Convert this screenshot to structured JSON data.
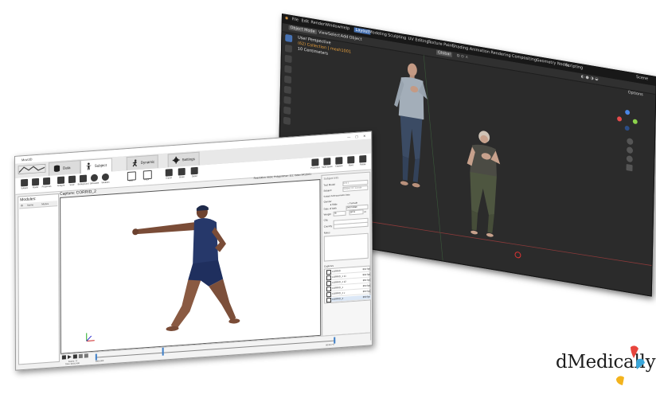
{
  "blender": {
    "menu": [
      "File",
      "Edit",
      "Render",
      "Window",
      "Help"
    ],
    "workspaces": [
      "Layout",
      "Modeling",
      "Sculpting",
      "UV Editing",
      "Texture Paint",
      "Shading",
      "Animation",
      "Rendering",
      "Compositing",
      "Geometry Nodes",
      "Scripting"
    ],
    "active_workspace": "Layout",
    "scene_label": "Scene",
    "header": {
      "mode": "Object Mode",
      "menus": [
        "View",
        "Select",
        "Add",
        "Object"
      ],
      "orientation": "Global",
      "options_label": "Options"
    },
    "overlay": {
      "line1": "User Perspective",
      "line2": "(62) Collection | mesh1001",
      "line3": "10 Centimeters"
    },
    "colors": {
      "active_tab": "#4772b3",
      "axis_x": "#e64a4a",
      "axis_y": "#8bd14b",
      "axis_z": "#4a86e6",
      "overlay_text_orange": "#e8a03c"
    }
  },
  "app": {
    "window_title": "Muvi3D",
    "tabs": [
      {
        "label": "Data",
        "icon": "database-icon"
      },
      {
        "label": "Subject",
        "icon": "person-icon"
      },
      {
        "label": "Dynamic",
        "icon": "running-person-icon"
      },
      {
        "label": "Settings",
        "icon": "gear-icon"
      }
    ],
    "active_tab": "Subject",
    "ribbon_left": [
      "Subject",
      "Model",
      "Properties",
      "Analyze",
      "Save",
      "Background",
      "Silhouette",
      "Skeleton"
    ],
    "ribbon_mid": [
      "Grid",
      "Floor"
    ],
    "ribbon_right": [
      "Export",
      "Share",
      "Detail"
    ],
    "action_buttons": [
      "Properties",
      "Save scene",
      "Capture",
      "Store",
      "Rotate"
    ],
    "modules_label": "Modules:",
    "modules_columns": [
      "Name",
      "Modes"
    ],
    "capture_title": "Capture: CORRID_2",
    "capture_stats": "Resolution: 960x; Polygonmax: 111; Index 8412021",
    "right_panel": {
      "title": "Subject Info",
      "fields": [
        {
          "label": "Test Model",
          "value": "Unit 1"
        },
        {
          "label": "Subject",
          "value": "Subject_02_Female"
        }
      ],
      "section": "Subject Anthropometric Data",
      "gender_label": "Gender",
      "gender_options": [
        "Male",
        "Female"
      ],
      "date_label": "Date of birth",
      "date_value": "24/07/1990",
      "weight_label": "Weight",
      "weight_value": "78",
      "height_value": "187.5",
      "height_unit": "m",
      "city_label": "City",
      "country_label": "Country",
      "notes_label": "Notes",
      "captures_label": "Captures",
      "captures": [
        {
          "name": "CORRID",
          "count": "850 fps"
        },
        {
          "name": "CORRID_1 k1",
          "count": "850 fps"
        },
        {
          "name": "CORRID_1 k2",
          "count": "850 fps"
        },
        {
          "name": "CORRID_1",
          "count": "850 fps"
        },
        {
          "name": "CORRID_1 v",
          "count": "850 fps"
        },
        {
          "name": "CORRID_2",
          "count": "850 fps"
        }
      ],
      "bottom_buttons": [
        "Delete",
        "Open",
        "Update",
        "Add",
        "Remove"
      ]
    },
    "timeline": {
      "frame_label": "Frame: 77",
      "time_label": "Time: 00:01.400",
      "start": "0000.000",
      "end": "00:00.777"
    }
  },
  "logo": {
    "text": "dMedically",
    "accent_colors": [
      "#e8453c",
      "#3aa6d9",
      "#f3b31d"
    ]
  }
}
